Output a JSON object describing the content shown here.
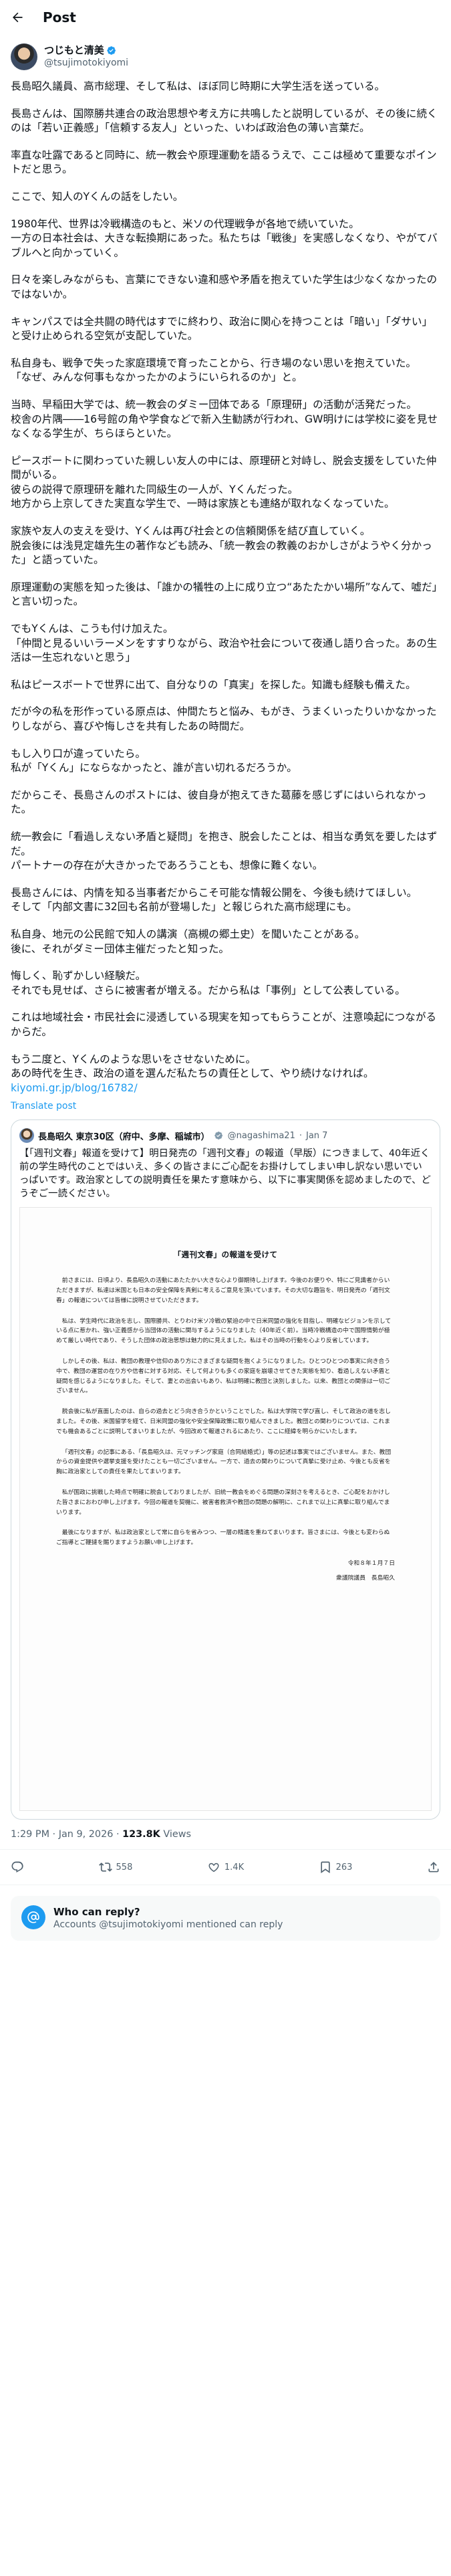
{
  "topbar": {
    "title": "Post"
  },
  "author": {
    "name": "つじもと清美",
    "handle": "@tsujimotokiyomi"
  },
  "post": {
    "paragraphs": [
      "長島昭久議員、高市総理、そして私は、ほぼ同じ時期に大学生活を送っている。",
      "長島さんは、国際勝共連合の政治思想や考え方に共鳴したと説明しているが、その後に続くのは「若い正義感」「信頼する友人」といった、いわば政治色の薄い言葉だ。",
      "率直な吐露であると同時に、統一教会や原理運動を語るうえで、ここは極めて重要なポイントだと思う。",
      "ここで、知人のYくんの話をしたい。",
      "1980年代、世界は冷戦構造のもと、米ソの代理戦争が各地で続いていた。\n一方の日本社会は、大きな転換期にあった。私たちは「戦後」を実感しなくなり、やがてバブルへと向かっていく。",
      "日々を楽しみながらも、言葉にできない違和感や矛盾を抱えていた学生は少なくなかったのではないか。",
      "キャンパスでは全共闘の時代はすでに終わり、政治に関心を持つことは「暗い」「ダサい」と受け止められる空気が支配していた。",
      "私自身も、戦争で失った家庭環境で育ったことから、行き場のない思いを抱えていた。\n「なぜ、みんな何事もなかったかのようにいられるのか」と。",
      "当時、早稲田大学では、統一教会のダミー団体である「原理研」の活動が活発だった。\n校舎の片隅――16号館の角や学食などで新入生勧誘が行われ、GW明けには学校に姿を見せなくなる学生が、ちらほらといた。",
      "ピースボートに関わっていた親しい友人の中には、原理研と対峙し、脱会支援をしていた仲間がいる。\n彼らの説得で原理研を離れた同級生の一人が、Yくんだった。\n地方から上京してきた実直な学生で、一時は家族とも連絡が取れなくなっていた。",
      "家族や友人の支えを受け、Yくんは再び社会との信頼関係を結び直していく。\n脱会後には浅見定雄先生の著作なども読み、「統一教会の教義のおかしさがようやく分かった」と語っていた。",
      "原理運動の実態を知った後は、「誰かの犠牲の上に成り立つ“あたたかい場所”なんて、嘘だ」と言い切った。",
      "でもYくんは、こうも付け加えた。\n「仲間と見るいいラーメンをすすりながら、政治や社会について夜通し語り合った。あの生活は一生忘れないと思う」",
      "私はピースボートで世界に出て、自分なりの「真実」を探した。知識も経験も備えた。",
      "だが今の私を形作っている原点は、仲間たちと悩み、もがき、うまくいったりいかなかったりしながら、喜びや悔しさを共有したあの時間だ。",
      "もし入り口が違っていたら。\n私が「Yくん」にならなかったと、誰が言い切れるだろうか。",
      "だからこそ、長島さんのポストには、彼自身が抱えてきた葛藤を感じずにはいられなかった。",
      "統一教会に「看過しえない矛盾と疑問」を抱き、脱会したことは、相当な勇気を要したはずだ。\nパートナーの存在が大きかったであろうことも、想像に難くない。",
      "長島さんには、内情を知る当事者だからこそ可能な情報公開を、今後も続けてほしい。\nそして「内部文書に32回も名前が登場した」と報じられた高市総理にも。",
      "私自身、地元の公民館で知人の講演（高槻の郷土史）を聞いたことがある。\n後に、それがダミー団体主催だったと知った。",
      "悔しく、恥ずかしい経験だ。\nそれでも見せば、さらに被害者が増える。だから私は「事例」として公表している。",
      "これは地域社会・市民社会に浸透している現実を知ってもらうことが、注意喚起につながるからだ。",
      "もう二度と、Yくんのような思いをさせないために。\nあの時代を生き、政治の道を選んだ私たちの責任として、やり続けなければ。"
    ],
    "link": "kiyomi.gr.jp/blog/16782/",
    "translate_label": "Translate post"
  },
  "quote": {
    "name": "長島昭久 東京30区（府中、多摩、稲城市）",
    "handle": "@nagashima21",
    "date": "Jan 7",
    "text": "【「週刊文春」報道を受けて】明日発売の「週刊文春」の報道（早版）につきまして、40年近く前の学生時代のことではいえ、多くの皆さまにご心配をお掛けしてしまい申し訳ない思いでいっぱいです。政治家としての説明責任を果たす意味から、以下に事実関係を認めましたので、どうぞご一読ください。",
    "doc": {
      "title": "「週刊文春」の報道を受けて",
      "paragraphs": [
        "前さまには、日頃より、長島昭久の活動にあたたかい大きな心より御期待し上げます。今後のお便りや、特にご見識者からいただきますが、私達は米国とも日本の安全保障を真剣に考えるご意見を頂いています。その大切な趣旨を、明日発売の「週刊文春」の報道については皆様に説明させていただきます。",
        "私は、学生時代に政治を志し、国際勝共、とりわけ米ソ冷戦の緊迫の中で日米同盟の強化を目指し、明確なビジョンを示している点に惹かれ、強い正義感から当団体の活動に関与するようになりました（40年近く前）。当時冷戦構造の中で国際情勢が極めて厳しい時代であり、そうした団体の政治思想は魅力的に見えました。私はその当時の行動を心より反省しています。",
        "しかしその後、私は、教団の教理や信仰のあり方にさまざまな疑問を抱くようになりました。ひとつひとつの事実に向き合う中で、教団の運営の在り方や信者に対する対応、そして何よりも多くの家庭を崩壊させてきた実態を知り、看過しえない矛盾と疑問を感じるようになりました。そして、妻との出会いもあり、私は明確に教団と決別しました。以来、教団との関係は一切ございません。",
        "脱会後に私が直面したのは、自らの過去とどう向き合うかということでした。私は大学院で学び直し、そして政治の道を志しました。その後、米国留学を経て、日米同盟の強化や安全保障政策に取り組んできました。教団との関わりについては、これまでも機会あるごとに説明してまいりましたが、今回改めて報道されるにあたり、ここに経緯を明らかにいたします。",
        "「週刊文春」の記事にある、「長島昭久は、元マッチング家庭（合同結婚式）」等の記述は事実ではございません。また、教団からの資金提供や選挙支援を受けたことも一切ございません。一方で、過去の関わりについて真摯に受け止め、今後とも反省を胸に政治家としての責任を果たしてまいります。",
        "私が国政に挑戦した時点で明確に脱会しておりましたが、旧統一教会をめぐる問題の深刻さを考えるとき、ご心配をおかけした皆さまにおわび申し上げます。今回の報道を契機に、被害者救済や教団の問題の解明に、これまで以上に真摯に取り組んでまいります。",
        "最後になりますが、私は政治家として常に自らを省みつつ、一層の精進を重ねてまいります。皆さまには、今後とも変わらぬご指導とご鞭撻を賜りますようお願い申し上げます。"
      ],
      "date": "令和８年１月７日",
      "signature": "衆議院議員　長島昭久"
    }
  },
  "meta": {
    "time": "1:29 PM · Jan 9, 2026",
    "views_count": "123.8K",
    "views_label": "Views"
  },
  "actions": {
    "reposts": "558",
    "likes": "1.4K",
    "bookmarks": "263"
  },
  "reply_box": {
    "title": "Who can reply?",
    "subtitle": "Accounts @tsujimotokiyomi mentioned can reply"
  },
  "colors": {
    "accent": "#1d9bf0",
    "text": "#0f1419",
    "muted": "#536471",
    "border": "#cfd9de"
  }
}
